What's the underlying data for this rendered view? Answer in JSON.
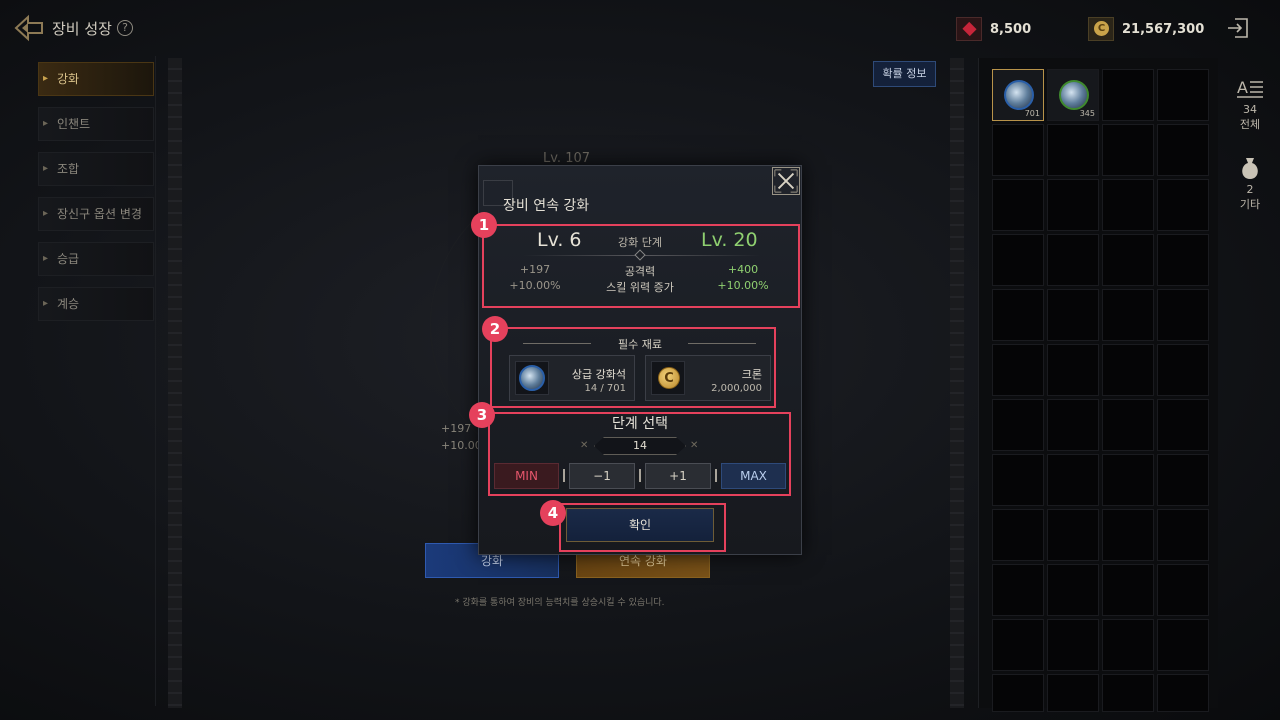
{
  "header": {
    "title": "장비 성장",
    "help": "?",
    "gems": "8,500",
    "gold": "21,567,300"
  },
  "menu": [
    {
      "label": "강화",
      "active": true
    },
    {
      "label": "인챈트",
      "active": false
    },
    {
      "label": "조합",
      "active": false
    },
    {
      "label": "장신구 옵션 변경",
      "active": false
    },
    {
      "label": "승급",
      "active": false
    },
    {
      "label": "계승",
      "active": false
    }
  ],
  "background": {
    "prob_info": "확률 정보",
    "level": "Lv. 107",
    "stat1": "+197",
    "stat2": "+10.00",
    "btn_enhance": "강화",
    "btn_continuous": "연속 강화",
    "note": "* 강화를 통하여 장비의 능력치를 상승시킬 수 있습니다."
  },
  "inventory": {
    "slots": [
      {
        "count": "701",
        "color": "blue"
      },
      {
        "count": "345",
        "color": "green"
      }
    ],
    "filters": [
      {
        "count": "34",
        "label": "전체",
        "icon": "sort-icon"
      },
      {
        "count": "2",
        "label": "기타",
        "icon": "bag-icon"
      }
    ]
  },
  "modal": {
    "title": "장비 연속 강화",
    "current_level": "Lv. 6",
    "stage_label": "강화 단계",
    "target_level": "Lv. 20",
    "cur_attack": "+197",
    "cur_skill": "+10.00%",
    "attack_label": "공격력",
    "skill_label": "스킬 위력 증가",
    "new_attack": "+400",
    "new_skill": "+10.00%",
    "materials_label": "필수 재료",
    "materials": [
      {
        "name": "상급 강화석",
        "count": "14 / 701"
      },
      {
        "name": "크론",
        "count": "2,000,000"
      }
    ],
    "step_label": "단계 선택",
    "step_value": "14",
    "btn_min": "MIN",
    "btn_minus": "−1",
    "btn_plus": "+1",
    "btn_max": "MAX",
    "confirm": "확인"
  },
  "badges": [
    "1",
    "2",
    "3",
    "4"
  ],
  "colors": {
    "highlight": "#e5415c",
    "green": "#8fd070",
    "gold": "#c9a24e"
  }
}
